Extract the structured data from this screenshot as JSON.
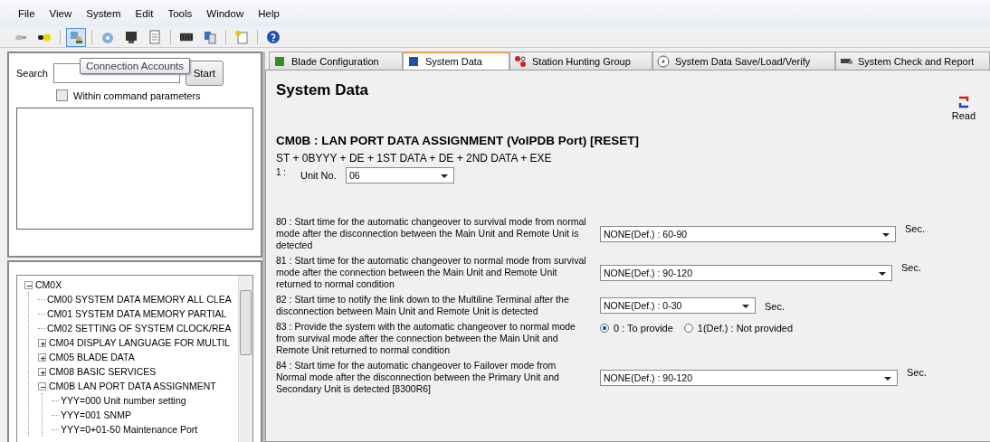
{
  "menu": [
    "File",
    "View",
    "System",
    "Edit",
    "Tools",
    "Window",
    "Help"
  ],
  "toolbar": [
    {
      "selected": false
    },
    {
      "selected": false
    },
    {
      "selected": true
    },
    {
      "selected": false
    },
    {
      "selected": false
    },
    {
      "selected": false
    },
    {
      "selected": false
    },
    {
      "selected": false
    },
    {
      "selected": false
    },
    {
      "selected": false
    }
  ],
  "tooltip": "Connection Accounts",
  "search": {
    "label": "Search",
    "button": "Start",
    "option": {
      "label": "Within command parameters",
      "checked": false
    }
  },
  "tree": [
    {
      "label": "CM0X",
      "expanded": true,
      "children": [
        {
          "label": "CM00 SYSTEM DATA MEMORY ALL CLEA"
        },
        {
          "label": "CM01 SYSTEM DATA MEMORY PARTIAL"
        },
        {
          "label": "CM02 SETTING OF SYSTEM CLOCK/REA"
        },
        {
          "label": "CM04 DISPLAY LANGUAGE FOR MULTIL",
          "expanded": false
        },
        {
          "label": "CM05 BLADE DATA",
          "expanded": false
        },
        {
          "label": "CM08 BASIC SERVICES",
          "expanded": false
        },
        {
          "label": "CM0B LAN PORT DATA ASSIGNMENT",
          "expanded": true,
          "children": [
            {
              "label": "YYY=000 Unit number setting"
            },
            {
              "label": "YYY=001 SNMP"
            },
            {
              "label": "YYY=0+01-50 Maintenance Port"
            }
          ]
        }
      ]
    }
  ],
  "tabs": [
    {
      "label": "Blade Configuration",
      "selected": false
    },
    {
      "label": "System Data",
      "selected": true
    },
    {
      "label": "Station Hunting Group",
      "selected": false
    },
    {
      "label": "System Data Save/Load/Verify",
      "selected": false
    },
    {
      "label": "System Check and Report",
      "selected": false
    }
  ],
  "page_title": "System Data",
  "read_button": "Read",
  "command": {
    "title": "CM0B : LAN PORT DATA ASSIGNMENT (VoIPDB Port) [RESET]",
    "syntax": "ST + 0BYYY + DE + 1ST DATA + DE + 2ND DATA + EXE",
    "index": "1 :",
    "field_label": "Unit No.",
    "field_value": "06"
  },
  "settings": [
    {
      "kind": "select",
      "description": "80 : Start time for the automatic changeover to survival mode from normal mode after the disconnection between the Main Unit and Remote Unit is detected",
      "value": "NONE(Def.) : 60-90",
      "unit": "Sec."
    },
    {
      "kind": "select",
      "description": "81 : Start time for the automatic changeover to normal mode from survival mode after the connection between the Main Unit and Remote Unit returned to normal condition",
      "value": "NONE(Def.) : 90-120",
      "unit": "Sec."
    },
    {
      "kind": "select",
      "description": "82 : Start time to notify the link down to the Multiline Terminal after the disconnection between Main Unit and Remote Unit is detected",
      "value": "NONE(Def.) : 0-30",
      "unit": "Sec."
    },
    {
      "kind": "radio",
      "description": "83 : Provide the system with the automatic changeover to normal mode from survival mode after the connection between the Main Unit and Remote Unit returned to normal condition",
      "options": [
        {
          "label": "0 : To provide",
          "selected": true
        },
        {
          "label": "1(Def.) : Not provided",
          "selected": false
        }
      ]
    },
    {
      "kind": "select",
      "description": "84 : Start time for the automatic changeover to Failover mode from Normal mode after the disconnection between the Primary Unit and Secondary Unit is detected [8300R6]",
      "value": "NONE(Def.) : 90-120",
      "unit": "Sec."
    }
  ]
}
